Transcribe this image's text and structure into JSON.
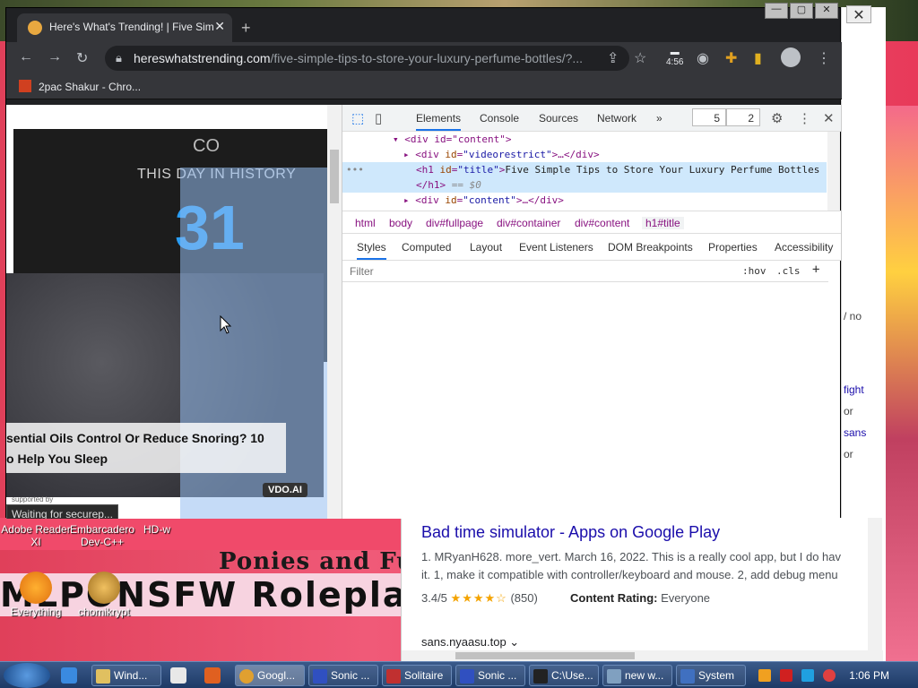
{
  "browser": {
    "tab_title": "Here's What's Trending! | Five Sim",
    "url_host": "hereswhatstrending.com",
    "url_path": "/five-simple-tips-to-store-your-luxury-perfume-bottles/?...",
    "download_time": "4:56",
    "bookmark": "2pac Shakur - Chro...",
    "status": "Waiting for securep..."
  },
  "page": {
    "ad_heading": "THIS DAY IN HISTORY",
    "ad_day": "31",
    "ad_fragment": "CO",
    "video_caption_line1": "sential Oils Control Or Reduce Snoring? 10",
    "video_caption_line2": "o Help You Sleep",
    "vdo_badge": "VDO.AI",
    "supported_by": "supported by"
  },
  "devtools": {
    "tabs": [
      "Elements",
      "Console",
      "Sources",
      "Network"
    ],
    "more": "»",
    "counter_errors": "5",
    "counter_issues": "2",
    "dom": {
      "line0": "<div id=\"content\">",
      "line1_tag": "<div",
      "line1_attr": "id",
      "line1_val": "\"videorestrict\"",
      "line1_rest": ">…</div>",
      "line2_open": "<h1",
      "line2_attr": "id",
      "line2_val": "\"title\"",
      "line2_text": "Five Simple Tips to Store Your Luxury Perfume Bottles",
      "line3_close": "</h1>",
      "line3_eq": "== $0",
      "line4_tag": "<div",
      "line4_attr": "id",
      "line4_val": "\"content\"",
      "line4_rest": ">…</div>",
      "ellipsis": "•••"
    },
    "breadcrumbs": [
      "html",
      "body",
      "div#fullpage",
      "div#container",
      "div#content",
      "h1#title"
    ],
    "sub_tabs": [
      "Styles",
      "Computed",
      "Layout",
      "Event Listeners",
      "DOM Breakpoints",
      "Properties",
      "Accessibility"
    ],
    "filter_placeholder": "Filter",
    "hov": ":hov",
    "cls": ".cls",
    "plus": "+"
  },
  "search_result": {
    "title": "Bad time simulator - Apps on Google Play",
    "snippet_line1": "1. MRyanH628. more_vert. March 16, 2022. This is a really cool app, but I do hav",
    "snippet_line2": "it. 1, make it compatible with controller/keyboard and mouse. 2, add debug menu",
    "rating": "3.4/5",
    "stars": "★★★★☆",
    "rating_count": "(850)",
    "content_rating_label": "Content Rating:",
    "content_rating_value": "Everyone",
    "site": "sans.nyaasu.top ⌄"
  },
  "background_window": {
    "snip1": "/ no",
    "snip2": "fight",
    "snip3": "or",
    "snip4": "sans",
    "snip5": "or",
    "close": "✕"
  },
  "desktop": {
    "icons": [
      {
        "label": "Adobe Reader XI"
      },
      {
        "label": "Embarcadero Dev-C++"
      },
      {
        "label": "HD-w"
      },
      {
        "label": "Everything"
      },
      {
        "label": "chomikrypt"
      }
    ],
    "banner_top": "Ponies and Fu",
    "banner_bottom": "MLPONSFW Roleplay"
  },
  "taskbar": {
    "tasks": [
      "Wind...",
      "Googl...",
      "Sonic ...",
      "Solitaire",
      "Sonic ...",
      "C:\\Use...",
      "new w...",
      "System"
    ],
    "clock": "1:06 PM"
  },
  "colors": {
    "accent": "#1a73e8",
    "chrome_dark": "#202124",
    "link": "#1a0dab"
  }
}
